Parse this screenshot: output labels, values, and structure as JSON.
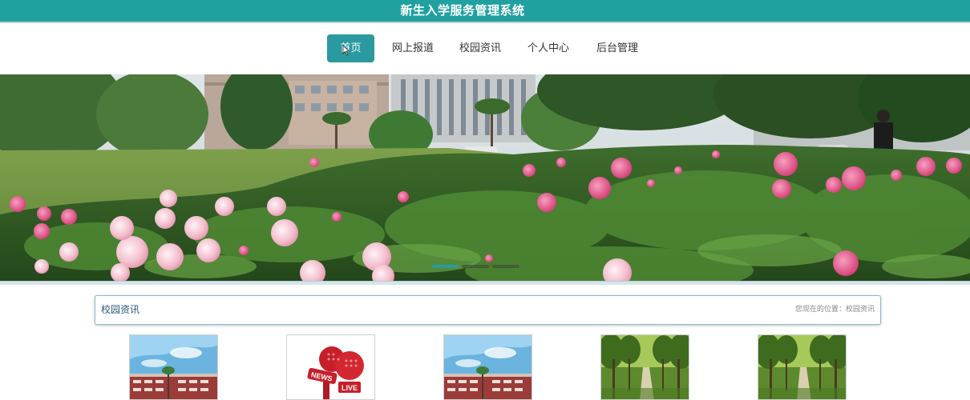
{
  "header": {
    "site_title": "新生入学服务管理系统",
    "accent_color": "#21a0a0"
  },
  "nav": {
    "items": [
      {
        "label": "首页",
        "active": true
      },
      {
        "label": "网上报道",
        "active": false
      },
      {
        "label": "校园资讯",
        "active": false
      },
      {
        "label": "个人中心",
        "active": false
      },
      {
        "label": "后台管理",
        "active": false
      }
    ]
  },
  "banner": {
    "image": "campus-peony-garden-photo",
    "carousel": {
      "slides": 3,
      "active_index": 0
    }
  },
  "news": {
    "section_title": "校园资讯",
    "location_text": "您现在的位置：校园资讯",
    "cards": [
      {
        "image": "campus-building-sky-photo"
      },
      {
        "image": "news-live-microphone-image"
      },
      {
        "image": "campus-building-sky-photo"
      },
      {
        "image": "tree-lined-path-photo"
      },
      {
        "image": "tree-lined-path-photo"
      }
    ]
  }
}
